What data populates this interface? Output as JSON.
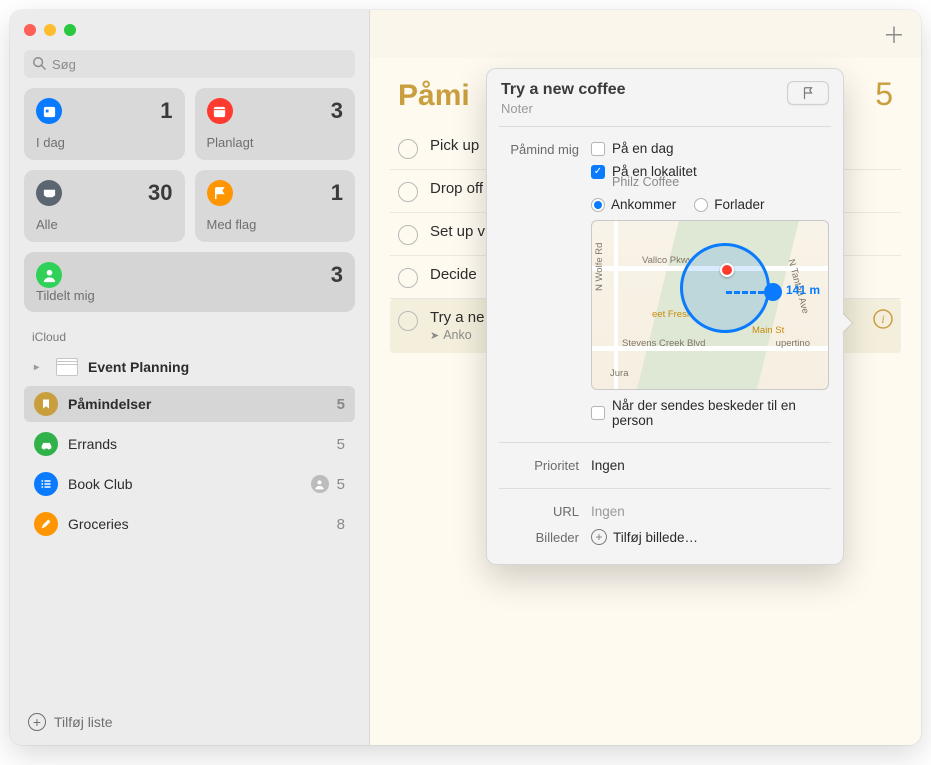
{
  "search": {
    "placeholder": "Søg"
  },
  "smart": {
    "today": {
      "label": "I dag",
      "count": "1"
    },
    "scheduled": {
      "label": "Planlagt",
      "count": "3"
    },
    "all": {
      "label": "Alle",
      "count": "30"
    },
    "flagged": {
      "label": "Med flag",
      "count": "1"
    },
    "assigned": {
      "label": "Tildelt mig",
      "count": "3"
    }
  },
  "section": "iCloud",
  "lists": {
    "eventPlanning": {
      "label": "Event Planning"
    },
    "reminders": {
      "label": "Påmindelser",
      "count": "5"
    },
    "errands": {
      "label": "Errands",
      "count": "5"
    },
    "bookClub": {
      "label": "Book Club",
      "count": "5"
    },
    "groceries": {
      "label": "Groceries",
      "count": "8"
    }
  },
  "addList": "Tilføj liste",
  "main": {
    "title": "Påmindelser",
    "titleTruncated": "Påmi",
    "count": "5",
    "reminders": [
      "Pick up",
      "Drop off",
      "Set up v",
      "Decide"
    ],
    "selected": {
      "title": "Try a ne",
      "sub": "Anko"
    }
  },
  "pop": {
    "title": "Try a new coffee",
    "notesPlaceholder": "Noter",
    "remindMe": "Påmind mig",
    "onDay": "På en dag",
    "onLocation": "På en lokalitet",
    "locationName": "Philz Coffee",
    "arriving": "Ankommer",
    "leaving": "Forlader",
    "whenMessaging": "Når der sendes beskeder til en person",
    "distance": "141 m",
    "priorityLabel": "Prioritet",
    "priorityValue": "Ingen",
    "urlLabel": "URL",
    "urlPlaceholder": "Ingen",
    "imagesLabel": "Billeder",
    "addImage": "Tilføj billede…",
    "mapLabels": {
      "vallco": "Vallco Pkwy",
      "wolfe": "N Wolfe Rd",
      "stevens": "Stevens Creek Blvd",
      "tantau": "N Tantau Ave",
      "cupertino": "upertino",
      "jura": "Jura",
      "meetfresh": "eet Fresh",
      "mainst": "Main St"
    }
  }
}
